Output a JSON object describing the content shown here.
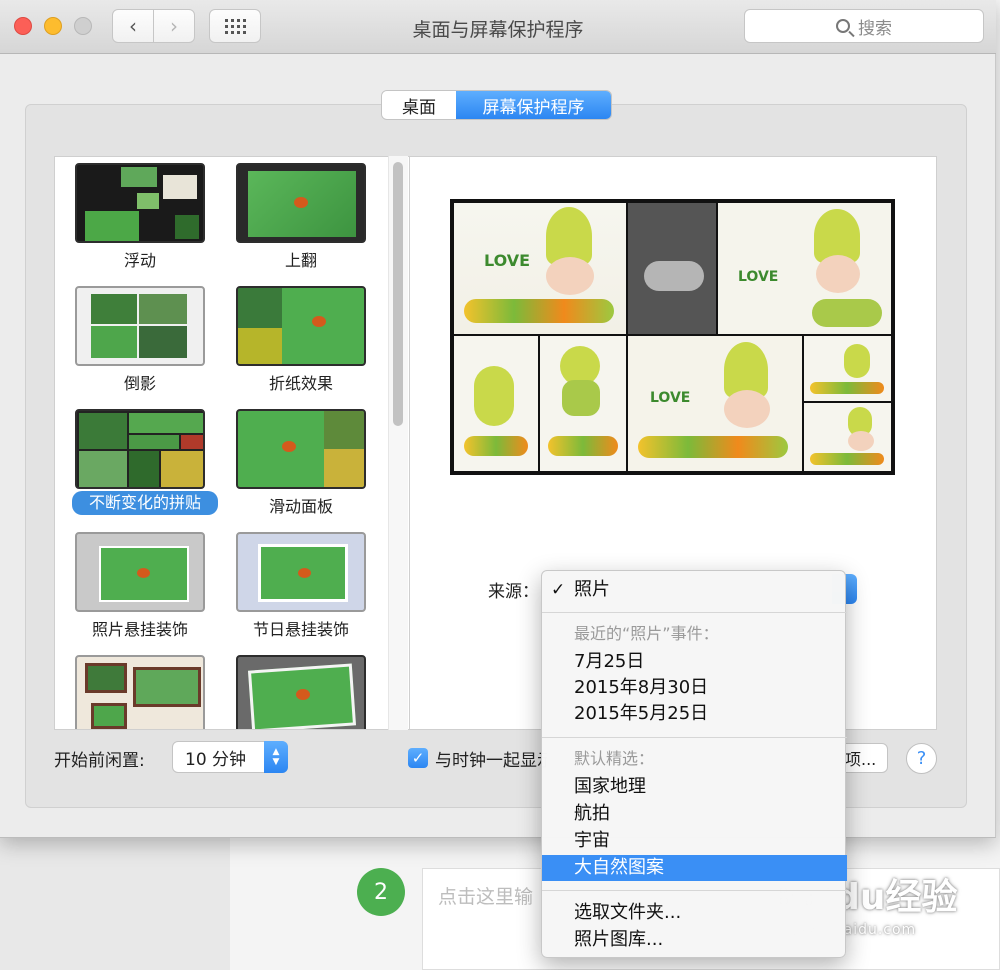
{
  "window": {
    "title": "桌面与屏幕保护程序",
    "search_placeholder": "搜索"
  },
  "tabs": [
    {
      "label": "桌面",
      "active": false
    },
    {
      "label": "屏幕保护程序",
      "active": true
    }
  ],
  "screensavers": [
    {
      "label": "浮动",
      "selected": false
    },
    {
      "label": "上翻",
      "selected": false
    },
    {
      "label": "倒影",
      "selected": false
    },
    {
      "label": "折纸效果",
      "selected": false
    },
    {
      "label": "不断变化的拼贴",
      "selected": true
    },
    {
      "label": "滑动面板",
      "selected": false
    },
    {
      "label": "照片悬挂装饰",
      "selected": false
    },
    {
      "label": "节日悬挂装饰",
      "selected": false
    }
  ],
  "preview": {
    "love_text": "LOVE"
  },
  "source": {
    "label": "来源：",
    "options_label": "项..."
  },
  "source_menu": {
    "checked_item": "照片",
    "recent_header": "最近的“照片”事件：",
    "recent_items": [
      "7月25日",
      "2015年8月30日",
      "2015年5月25日"
    ],
    "default_header": "默认精选：",
    "default_items": [
      "国家地理",
      "航拍",
      "宇宙",
      "大自然图案"
    ],
    "highlighted_item": "大自然图案",
    "bottom_items": [
      "选取文件夹...",
      "照片图库..."
    ]
  },
  "bottom": {
    "idle_label": "开始前闲置:",
    "idle_value": "10 分钟",
    "show_clock_label": "与时钟一起显示",
    "show_clock_checked": true,
    "help": "?"
  },
  "background_page": {
    "step_number": "2",
    "card_text": "点击这里输",
    "watermark": "Baidu经验",
    "watermark_url": "jingyan.baidu.com"
  },
  "colors": {
    "accent": "#3a8ff5",
    "selection": "#3d8fe0",
    "close": "#fc5f57",
    "minimize": "#fdbc2e"
  }
}
